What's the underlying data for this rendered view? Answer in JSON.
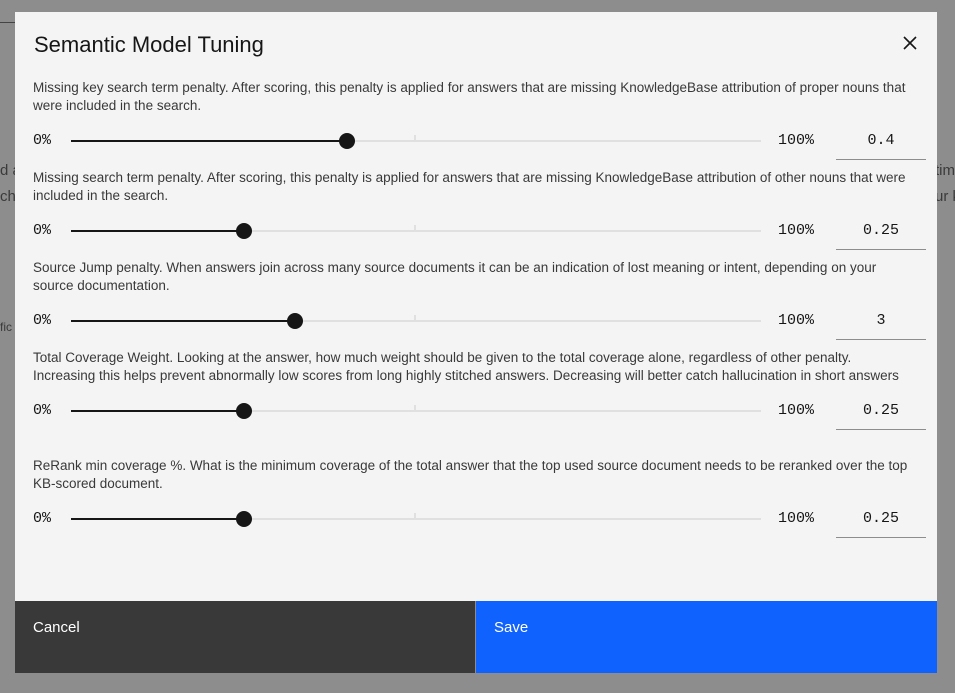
{
  "background": {
    "fragments": [
      "d a",
      "ch",
      "tim",
      "ur k",
      "fic"
    ]
  },
  "modal": {
    "title": "Semantic Model Tuning",
    "close_icon": "close-icon",
    "settings": [
      {
        "description": "Missing key search term penalty. After scoring, this penalty is applied for answers that are missing KnowledgeBase attribution of proper nouns that were included in the search.",
        "min_label": "0%",
        "max_label": "100%",
        "value": "0.4",
        "slider_fraction": 0.4
      },
      {
        "description": "Missing search term penalty. After scoring, this penalty is applied for answers that are missing KnowledgeBase attribution of other nouns that were included in the search.",
        "min_label": "0%",
        "max_label": "100%",
        "value": "0.25",
        "slider_fraction": 0.25
      },
      {
        "description": "Source Jump penalty. When answers join across many source documents it can be an indication of lost meaning or intent, depending on your source documentation.",
        "min_label": "0%",
        "max_label": "100%",
        "value": "3",
        "slider_fraction": 0.325
      },
      {
        "description": "Total Coverage Weight. Looking at the answer, how much weight should be given to the total coverage alone, regardless of other penalty. Increasing this helps prevent abnormally low scores from long highly stitched answers. Decreasing will better catch hallucination in short answers",
        "min_label": "0%",
        "max_label": "100%",
        "value": "0.25",
        "slider_fraction": 0.25
      },
      {
        "description": "ReRank min coverage %. What is the minimum coverage of the total answer that the top used source document needs to be reranked over the top KB-scored document.",
        "min_label": "0%",
        "max_label": "100%",
        "value": "0.25",
        "slider_fraction": 0.25
      }
    ],
    "footer": {
      "cancel_label": "Cancel",
      "save_label": "Save"
    }
  },
  "colors": {
    "primary": "#0f62fe",
    "secondary": "#393939",
    "overlay": "#8d8d8d"
  }
}
